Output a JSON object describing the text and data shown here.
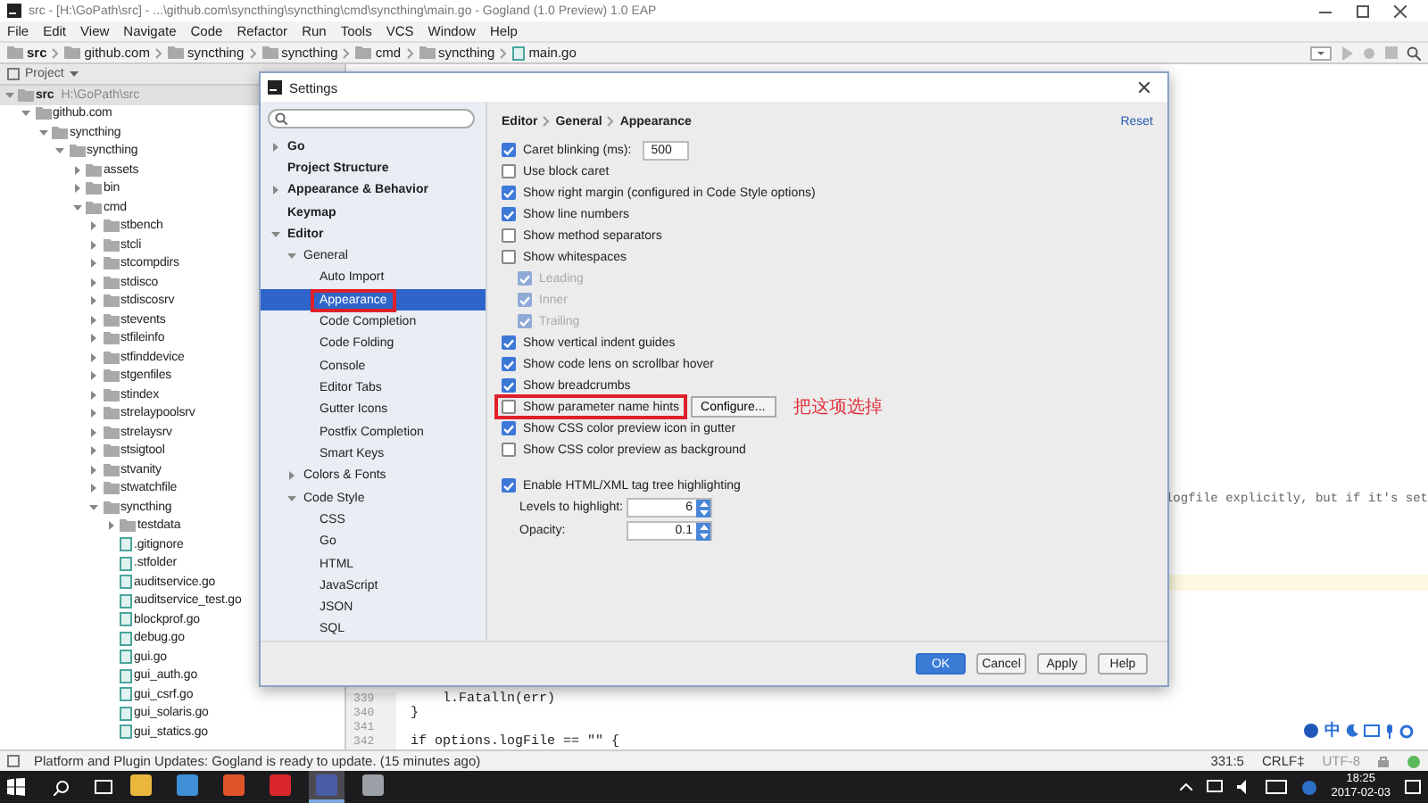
{
  "window": {
    "title": "src - [H:\\GoPath\\src] - ...\\github.com\\syncthing\\syncthing\\cmd\\syncthing\\main.go - Gogland (1.0 Preview) 1.0 EAP"
  },
  "menu": [
    "File",
    "Edit",
    "View",
    "Navigate",
    "Code",
    "Refactor",
    "Run",
    "Tools",
    "VCS",
    "Window",
    "Help"
  ],
  "nav_bar": [
    {
      "label": "src",
      "kind": "folder"
    },
    {
      "label": "github.com",
      "kind": "folder"
    },
    {
      "label": "syncthing",
      "kind": "folder"
    },
    {
      "label": "syncthing",
      "kind": "folder"
    },
    {
      "label": "cmd",
      "kind": "folder"
    },
    {
      "label": "syncthing",
      "kind": "folder"
    },
    {
      "label": "main.go",
      "kind": "file"
    }
  ],
  "project_panel": {
    "title": "Project",
    "tree": [
      {
        "label": "src",
        "path": "H:\\GoPath\\src",
        "kind": "folder",
        "expanded": true,
        "children": [
          {
            "label": "github.com",
            "kind": "folder",
            "expanded": true,
            "children": [
              {
                "label": "syncthing",
                "kind": "folder",
                "expanded": true,
                "children": [
                  {
                    "label": "syncthing",
                    "kind": "folder",
                    "expanded": true,
                    "children": [
                      {
                        "label": "assets",
                        "kind": "folder",
                        "expanded": false
                      },
                      {
                        "label": "bin",
                        "kind": "folder",
                        "expanded": false
                      },
                      {
                        "label": "cmd",
                        "kind": "folder",
                        "expanded": true,
                        "children": [
                          {
                            "label": "stbench",
                            "kind": "folder",
                            "expanded": false
                          },
                          {
                            "label": "stcli",
                            "kind": "folder",
                            "expanded": false
                          },
                          {
                            "label": "stcompdirs",
                            "kind": "folder",
                            "expanded": false
                          },
                          {
                            "label": "stdisco",
                            "kind": "folder",
                            "expanded": false
                          },
                          {
                            "label": "stdiscosrv",
                            "kind": "folder",
                            "expanded": false
                          },
                          {
                            "label": "stevents",
                            "kind": "folder",
                            "expanded": false
                          },
                          {
                            "label": "stfileinfo",
                            "kind": "folder",
                            "expanded": false
                          },
                          {
                            "label": "stfinddevice",
                            "kind": "folder",
                            "expanded": false
                          },
                          {
                            "label": "stgenfiles",
                            "kind": "folder",
                            "expanded": false
                          },
                          {
                            "label": "stindex",
                            "kind": "folder",
                            "expanded": false
                          },
                          {
                            "label": "strelaypoolsrv",
                            "kind": "folder",
                            "expanded": false
                          },
                          {
                            "label": "strelaysrv",
                            "kind": "folder",
                            "expanded": false
                          },
                          {
                            "label": "stsigtool",
                            "kind": "folder",
                            "expanded": false
                          },
                          {
                            "label": "stvanity",
                            "kind": "folder",
                            "expanded": false
                          },
                          {
                            "label": "stwatchfile",
                            "kind": "folder",
                            "expanded": false
                          },
                          {
                            "label": "syncthing",
                            "kind": "folder",
                            "expanded": true,
                            "children": [
                              {
                                "label": "testdata",
                                "kind": "folder",
                                "expanded": false
                              },
                              {
                                "label": ".gitignore",
                                "kind": "file"
                              },
                              {
                                "label": ".stfolder",
                                "kind": "file"
                              },
                              {
                                "label": "auditservice.go",
                                "kind": "file"
                              },
                              {
                                "label": "auditservice_test.go",
                                "kind": "file"
                              },
                              {
                                "label": "blockprof.go",
                                "kind": "file"
                              },
                              {
                                "label": "debug.go",
                                "kind": "file"
                              },
                              {
                                "label": "gui.go",
                                "kind": "file"
                              },
                              {
                                "label": "gui_auth.go",
                                "kind": "file"
                              },
                              {
                                "label": "gui_csrf.go",
                                "kind": "file"
                              },
                              {
                                "label": "gui_solaris.go",
                                "kind": "file"
                              },
                              {
                                "label": "gui_statics.go",
                                "kind": "file"
                              }
                            ]
                          }
                        ]
                      }
                    ]
                  }
                ]
              }
            ]
          }
        ]
      }
    ]
  },
  "editor": {
    "fragment": "logfile explicitly, but if it's set",
    "lines": [
      {
        "number": "339",
        "code": "    l.Fatalln(err)"
      },
      {
        "number": "340",
        "code": "}"
      },
      {
        "number": "341"
      },
      {
        "number": "342",
        "code": "if options.logFile == \"\" {"
      }
    ]
  },
  "settings": {
    "title": "Settings",
    "tree": [
      {
        "label": "Go",
        "expanded": false,
        "selected": false
      },
      {
        "label": "Project Structure",
        "selected": false
      },
      {
        "label": "Appearance & Behavior",
        "expanded": false,
        "selected": false
      },
      {
        "label": "Keymap",
        "selected": false
      },
      {
        "label": "Editor",
        "expanded": true,
        "selected": false,
        "children": [
          {
            "label": "General",
            "expanded": true,
            "selected": false,
            "children": [
              {
                "label": "Auto Import",
                "selected": false
              },
              {
                "label": "Appearance",
                "selected": true,
                "highlighted": true
              },
              {
                "label": "Code Completion",
                "selected": false
              },
              {
                "label": "Code Folding",
                "selected": false
              },
              {
                "label": "Console",
                "selected": false
              },
              {
                "label": "Editor Tabs",
                "selected": false
              },
              {
                "label": "Gutter Icons",
                "selected": false
              },
              {
                "label": "Postfix Completion",
                "selected": false
              },
              {
                "label": "Smart Keys",
                "selected": false
              }
            ]
          },
          {
            "label": "Colors & Fonts",
            "expanded": false,
            "selected": false
          },
          {
            "label": "Code Style",
            "expanded": true,
            "selected": false,
            "children": [
              {
                "label": "CSS",
                "selected": false
              },
              {
                "label": "Go",
                "selected": false
              },
              {
                "label": "HTML",
                "selected": false
              },
              {
                "label": "JavaScript",
                "selected": false
              },
              {
                "label": "JSON",
                "selected": false
              },
              {
                "label": "SQL",
                "selected": false
              }
            ]
          }
        ]
      }
    ],
    "breadcrumb": [
      "Editor",
      "General",
      "Appearance"
    ],
    "reset": "Reset",
    "option_groups": [
      [
        {
          "kind": "checkbox",
          "label": "Caret blinking (ms):",
          "checked": true,
          "value": "500"
        },
        {
          "kind": "checkbox",
          "label": "Use block caret",
          "checked": false
        },
        {
          "kind": "checkbox",
          "label": "Show right margin (configured in Code Style options)",
          "checked": true
        },
        {
          "kind": "checkbox",
          "label": "Show line numbers",
          "checked": true
        },
        {
          "kind": "checkbox",
          "label": "Show method separators",
          "checked": false
        },
        {
          "kind": "checkbox",
          "label": "Show whitespaces",
          "checked": false,
          "children": [
            {
              "kind": "checkbox",
              "label": "Leading",
              "checked": true,
              "disabled": true
            },
            {
              "kind": "checkbox",
              "label": "Inner",
              "checked": true,
              "disabled": true
            },
            {
              "kind": "checkbox",
              "label": "Trailing",
              "checked": true,
              "disabled": true
            }
          ]
        },
        {
          "kind": "checkbox",
          "label": "Show vertical indent guides",
          "checked": true
        },
        {
          "kind": "checkbox",
          "label": "Show code lens on scrollbar hover",
          "checked": true
        },
        {
          "kind": "checkbox",
          "label": "Show breadcrumbs",
          "checked": true
        },
        {
          "kind": "checkbox",
          "label": "Show parameter name hints",
          "checked": false,
          "highlighted": true,
          "button": "Configure...",
          "note": "把这项选掉"
        },
        {
          "kind": "checkbox",
          "label": "Show CSS color preview icon in gutter",
          "checked": true
        },
        {
          "kind": "checkbox",
          "label": "Show CSS color preview as background",
          "checked": false
        }
      ],
      [
        {
          "kind": "checkbox",
          "label": "Enable HTML/XML tag tree highlighting",
          "checked": true,
          "children": [
            {
              "kind": "spinner",
              "label": "Levels to highlight:",
              "value": "6"
            },
            {
              "kind": "spinner",
              "label": "Opacity:",
              "value": "0.1"
            }
          ]
        }
      ]
    ],
    "buttons": [
      {
        "label": "OK",
        "primary": true
      },
      {
        "label": "Cancel",
        "primary": false
      },
      {
        "label": "Apply",
        "primary": false
      },
      {
        "label": "Help",
        "primary": false
      }
    ]
  },
  "status_bar": {
    "message": "Platform and Plugin Updates: Gogland is ready to update. (15 minutes ago)",
    "position": "331:5",
    "line_ending": "CRLF‡",
    "encoding": "UTF-8"
  },
  "ime_bar": {
    "label": "中"
  },
  "taskbar": {
    "apps": [
      {
        "color": "#e8b73c",
        "selected": false
      },
      {
        "color": "#3f8fd8",
        "selected": false
      },
      {
        "color": "#e0542c",
        "selected": false
      },
      {
        "color": "#d9262c",
        "selected": false
      },
      {
        "color": "#4a5ca8",
        "selected": true
      },
      {
        "color": "#9aa0a6",
        "selected": false
      }
    ],
    "time": "18:25",
    "date": "2017-02-03"
  }
}
